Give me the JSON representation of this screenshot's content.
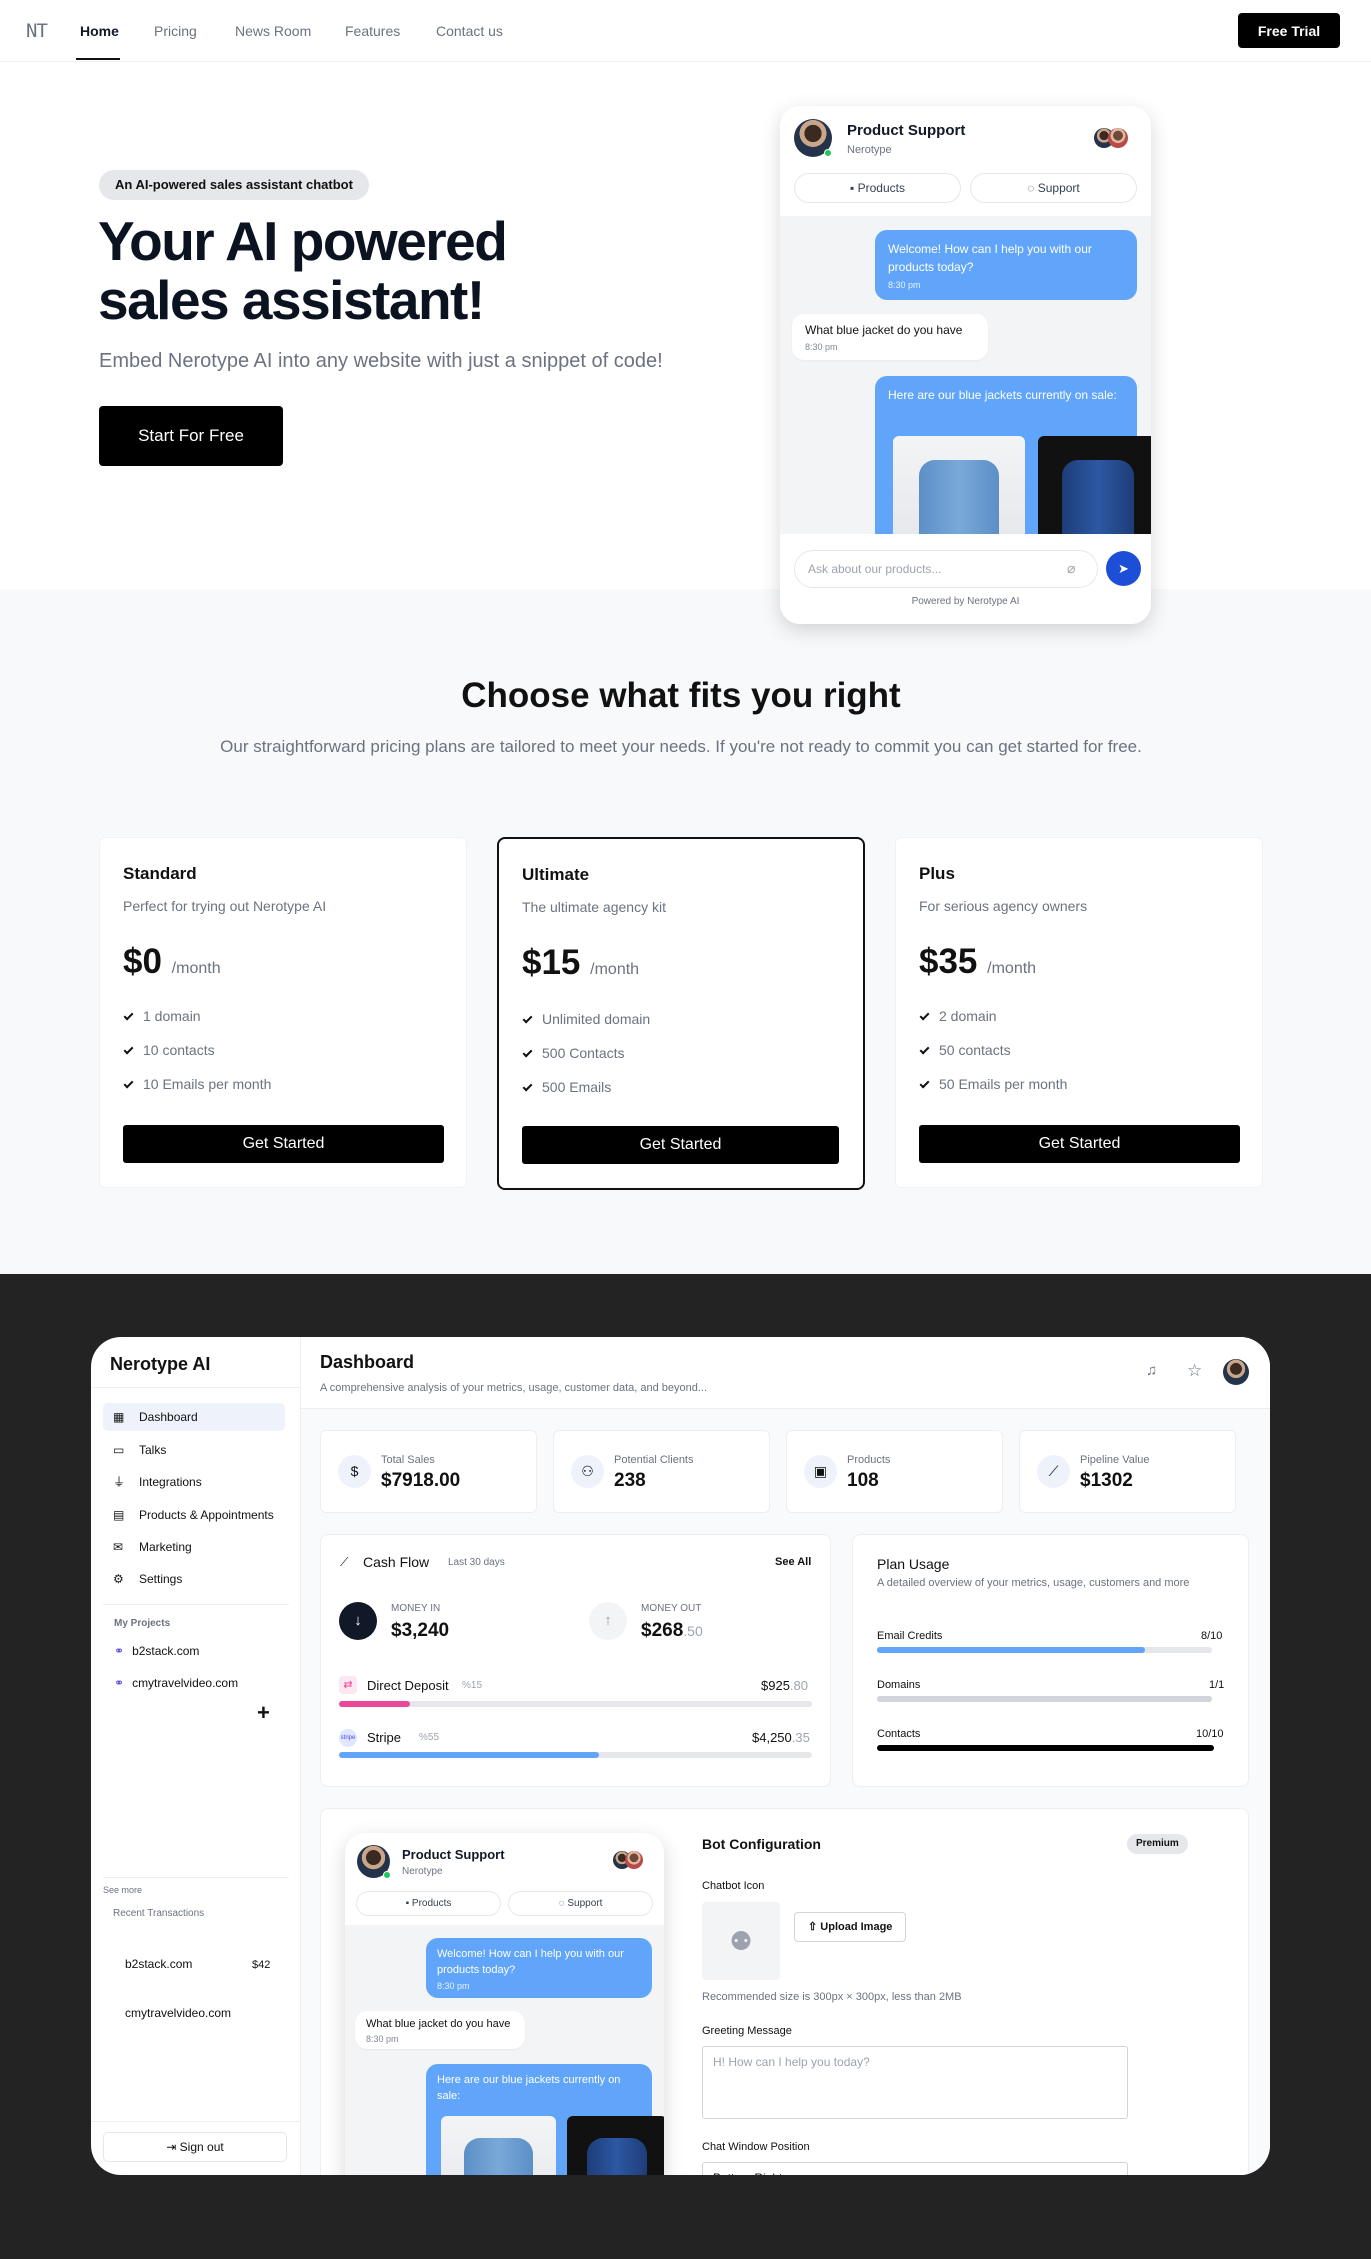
{
  "nav": {
    "logo": "NT",
    "links": [
      "Home",
      "Pricing",
      "News Room",
      "Features",
      "Contact us"
    ],
    "cta": "Free Trial"
  },
  "hero": {
    "badge": "An AI-powered sales assistant chatbot",
    "title_line1": "Your AI powered",
    "title_line2": "sales assistant!",
    "subtitle": "Embed Nerotype AI into any website with just a snippet of code!",
    "cta": "Start For Free"
  },
  "chat": {
    "title": "Product Support",
    "subtitle": "Nerotype",
    "tab_products": "Products",
    "tab_support": "Support",
    "msg1": "Welcome! How can I help you with our products today?",
    "msg1_time": "8:30 pm",
    "msg2": "What blue jacket do you have",
    "msg2_time": "8:30 pm",
    "msg3": "Here are our blue jackets currently on sale:",
    "input_placeholder": "Ask about our products...",
    "powered": "Powered by Nerotype AI"
  },
  "pricing": {
    "title": "Choose what fits you right",
    "subtitle": "Our straightforward pricing plans are tailored to meet your needs. If you're not ready to commit you can get started for free.",
    "plans": [
      {
        "name": "Standard",
        "desc": "Perfect for trying out Nerotype AI",
        "price": "$0",
        "period": "/month",
        "features": [
          "1 domain",
          "10 contacts",
          "10 Emails per month"
        ],
        "cta": "Get Started"
      },
      {
        "name": "Ultimate",
        "desc": "The ultimate agency kit",
        "price": "$15",
        "period": "/month",
        "features": [
          "Unlimited domain",
          "500 Contacts",
          "500 Emails"
        ],
        "cta": "Get Started"
      },
      {
        "name": "Plus",
        "desc": "For serious agency owners",
        "price": "$35",
        "period": "/month",
        "features": [
          "2 domain",
          "50 contacts",
          "50 Emails per month"
        ],
        "cta": "Get Started"
      }
    ]
  },
  "dashboard": {
    "brand": "Nerotype AI",
    "title": "Dashboard",
    "subtitle": "A comprehensive analysis of your metrics, usage, customer data, and beyond...",
    "sidebar": [
      {
        "label": "Dashboard",
        "icon": "grid-icon"
      },
      {
        "label": "Talks",
        "icon": "chat-icon"
      },
      {
        "label": "Integrations",
        "icon": "plug-icon"
      },
      {
        "label": "Products & Appointments",
        "icon": "calendar-icon"
      },
      {
        "label": "Marketing",
        "icon": "mail-icon"
      },
      {
        "label": "Settings",
        "icon": "gear-icon"
      }
    ],
    "projects_heading": "My Projects",
    "projects": [
      "b2stack.com",
      "cmytravelvideo.com"
    ],
    "see_more": "See more",
    "recent_heading": "Recent Transactions",
    "recent": [
      {
        "name": "b2stack.com",
        "amount": "$42"
      },
      {
        "name": "cmytravelvideo.com",
        "amount": ""
      }
    ],
    "sign_out": "Sign out",
    "stats": [
      {
        "label": "Total Sales",
        "value": "$7918.00",
        "icon": "dollar-icon"
      },
      {
        "label": "Potential Clients",
        "value": "238",
        "icon": "users-icon"
      },
      {
        "label": "Products",
        "value": "108",
        "icon": "calendar-icon"
      },
      {
        "label": "Pipeline Value",
        "value": "$1302",
        "icon": "trend-icon"
      }
    ],
    "cashflow": {
      "title": "Cash Flow",
      "range": "Last 30 days",
      "see_all": "See All",
      "money_in_label": "MONEY IN",
      "money_in": "$3,240",
      "money_out_label": "MONEY OUT",
      "money_out_main": "$268",
      "money_out_cents": ".50",
      "rows": [
        {
          "name": "Direct Deposit",
          "pct": "%15",
          "amount_main": "$925",
          "amount_cents": ".80",
          "fill": 0.15,
          "color": "#ec4899"
        },
        {
          "name": "Stripe",
          "pct": "%55",
          "amount_main": "$4,250",
          "amount_cents": ".35",
          "fill": 0.55,
          "color": "#60a5fa"
        }
      ],
      "stripe_logo": "stripe"
    },
    "plan_usage": {
      "title": "Plan Usage",
      "subtitle": "A detailed overview of your metrics, usage, customers and more",
      "rows": [
        {
          "label": "Email Credits",
          "value": "8/10",
          "fill": 0.8,
          "color": "#60a5fa"
        },
        {
          "label": "Domains",
          "value": "1/1",
          "fill": 1.0,
          "color": "#d1d5db"
        },
        {
          "label": "Contacts",
          "value": "10/10",
          "fill": 1.0,
          "color": "#000000"
        }
      ]
    },
    "bot_config": {
      "title": "Bot Configuration",
      "badge": "Premium",
      "icon_label": "Chatbot Icon",
      "upload": "Upload Image",
      "hint": "Recommended size is 300px × 300px, less than 2MB",
      "greeting_label": "Greeting Message",
      "greeting_placeholder": "H! How can I help you today?",
      "position_label": "Chat Window Position",
      "position_value": "Bottom Right"
    }
  }
}
